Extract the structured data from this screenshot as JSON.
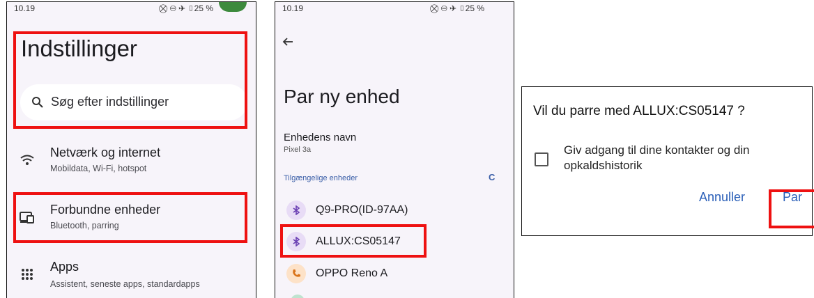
{
  "screen1": {
    "status_time": "10.19",
    "status_icons": "⛒ ⊖ ✈ ▯25 %",
    "title": "Indstillinger",
    "search_placeholder": "Søg efter indstillinger",
    "rows": [
      {
        "icon": "wifi-icon",
        "title": "Netværk og internet",
        "subtitle": "Mobildata, Wi-Fi, hotspot"
      },
      {
        "icon": "connected-devices-icon",
        "title": "Forbundne enheder",
        "subtitle": "Bluetooth, parring"
      },
      {
        "icon": "apps-grid-icon",
        "title": "Apps",
        "subtitle": "Assistent, seneste apps, standardapps"
      }
    ]
  },
  "screen2": {
    "status_time": "10.19",
    "status_icons": "⛒ ⊖ ✈ ▯25 %",
    "title": "Par ny enhed",
    "device_name_label": "Enhedens navn",
    "device_name_value": "Pixel 3a",
    "available_label": "Tilgængelige enheder",
    "refresh_glyph": "C",
    "devices": [
      {
        "icon": "bluetooth-icon",
        "name": "Q9-PRO(ID-97AA)"
      },
      {
        "icon": "bluetooth-icon",
        "name": "ALLUX:CS05147"
      },
      {
        "icon": "phone-icon",
        "name": "OPPO Reno A"
      }
    ]
  },
  "dialog": {
    "title": "Vil du parre med ALLUX:CS05147 ?",
    "checkbox_label": "Giv adgang til dine kontakter og din opkaldshistorik",
    "cancel_label": "Annuller",
    "pair_label": "Par"
  },
  "colors": {
    "highlight": "#ee1111",
    "accent": "#2a5fb8",
    "bluetooth_bg": "#e8dcf6",
    "phone_bg": "#fde2c8"
  }
}
